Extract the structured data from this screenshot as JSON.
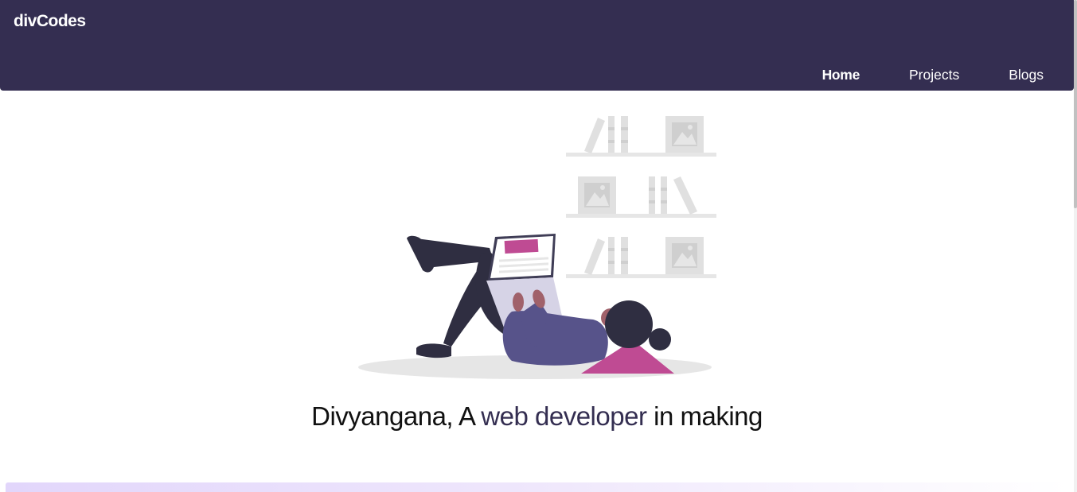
{
  "header": {
    "brand": "divCodes",
    "nav": {
      "home": "Home",
      "projects": "Projects",
      "blogs": "Blogs"
    }
  },
  "hero": {
    "title_prefix": "Divyangana, A ",
    "title_accent": "web developer",
    "title_suffix": " in making",
    "illustration": "person-lying-with-laptop-illustration"
  },
  "colors": {
    "navbar": "#342e51",
    "accent": "#342e51",
    "illustration_accent": "#bf4b93",
    "bottom_strip": "#e2d6fb"
  }
}
